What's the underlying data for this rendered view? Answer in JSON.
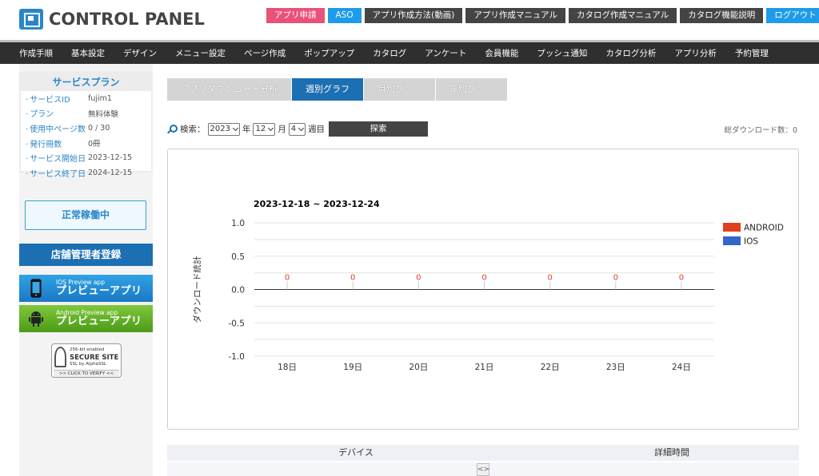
{
  "header": {
    "logo_text": "CONTROL PANEL",
    "buttons": [
      {
        "label": "アプリ申請",
        "color": "pink"
      },
      {
        "label": "ASO",
        "color": "blue"
      },
      {
        "label": "アプリ作成方法(動画)",
        "color": "dark"
      },
      {
        "label": "アプリ作成マニュアル",
        "color": "dark"
      },
      {
        "label": "カタログ作成マニュアル",
        "color": "dark"
      },
      {
        "label": "カタログ機能説明",
        "color": "dark"
      },
      {
        "label": "ログアウト",
        "color": "blue"
      }
    ]
  },
  "nav": [
    "作成手順",
    "基本設定",
    "デザイン",
    "メニュー設定",
    "ページ作成",
    "ポップアップ",
    "カタログ",
    "アンケート",
    "会員機能",
    "プッシュ通知",
    "カタログ分析",
    "アプリ分析",
    "予約管理"
  ],
  "sidebar": {
    "plan_title": "サービスプラン",
    "plan_rows": [
      {
        "key": "サービスID",
        "value": "fujim1"
      },
      {
        "key": "プラン",
        "value": "無料体験"
      },
      {
        "key": "使用中ページ数",
        "value": "0 / 30"
      },
      {
        "key": "発行冊数",
        "value": "0冊"
      },
      {
        "key": "サービス開始日",
        "value": "2023-12-15"
      },
      {
        "key": "サービス終了日",
        "value": "2024-12-15"
      }
    ],
    "status": "正常稼働中",
    "register": "店舗管理者登録",
    "ios_preview": {
      "small": "IOS Preview app",
      "big": "プレビューアプリ"
    },
    "android_preview": {
      "small": "Android Preview app",
      "big": "プレビューアプリ"
    },
    "ssl": {
      "line1": "256-bit enabled",
      "line2": "SECURE SITE",
      "line3": "SSL by AlphaSSL",
      "line4": ">> CLICK TO VERIFY <<"
    }
  },
  "tabs": [
    {
      "label": "アプリダウンロード分析",
      "active": false
    },
    {
      "label": "週別グラフ",
      "active": true
    },
    {
      "label": "月別グラフ",
      "active": false
    },
    {
      "label": "年別グラフ",
      "active": false
    }
  ],
  "search": {
    "label": "検索：",
    "year": "2023",
    "year_unit": "年",
    "month": "12",
    "month_unit": "月",
    "week": "4",
    "week_unit": "週目",
    "button": "探索"
  },
  "total_downloads": "総ダウンロード数：0",
  "chart_data": {
    "type": "bar",
    "title": "2023-12-18 ~ 2023-12-24",
    "ylabel": "ダウンロード統計",
    "xlabel": "",
    "categories": [
      "18日",
      "19日",
      "20日",
      "21日",
      "22日",
      "23日",
      "24日"
    ],
    "series": [
      {
        "name": "ANDROID",
        "values": [
          0,
          0,
          0,
          0,
          0,
          0,
          0
        ],
        "color": "#e0401e"
      },
      {
        "name": "IOS",
        "values": [
          0,
          0,
          0,
          0,
          0,
          0,
          0
        ],
        "color": "#3366cc"
      }
    ],
    "data_labels": [
      "0",
      "0",
      "0",
      "0",
      "0",
      "0",
      "0"
    ],
    "ylim": [
      -1.0,
      1.0
    ],
    "yticks": [
      "1.0",
      "0.5",
      "0.0",
      "-0.5",
      "-1.0"
    ],
    "ytick_values": [
      1.0,
      0.5,
      0.0,
      -0.5,
      -1.0
    ],
    "grid": true,
    "legend": "right"
  },
  "table": {
    "headers": [
      "デバイス",
      "詳細時間"
    ],
    "resize_glyph": "<>"
  }
}
